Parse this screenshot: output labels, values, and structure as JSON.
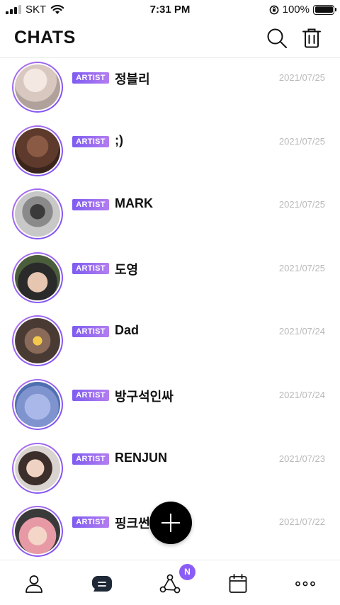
{
  "status_bar": {
    "carrier": "SKT",
    "time": "7:31 PM",
    "battery_percent": "100%"
  },
  "header": {
    "title": "CHATS",
    "search_icon": "search-icon",
    "trash_icon": "trash-icon"
  },
  "chats": [
    {
      "badge": "ARTIST",
      "name": "정블리",
      "date": "2021/07/25"
    },
    {
      "badge": "ARTIST",
      "name": ";)",
      "date": "2021/07/25"
    },
    {
      "badge": "ARTIST",
      "name": "MARK",
      "date": "2021/07/25"
    },
    {
      "badge": "ARTIST",
      "name": "도영",
      "date": "2021/07/25"
    },
    {
      "badge": "ARTIST",
      "name": "Dad",
      "date": "2021/07/24"
    },
    {
      "badge": "ARTIST",
      "name": "방구석인싸",
      "date": "2021/07/24"
    },
    {
      "badge": "ARTIST",
      "name": "RENJUN",
      "date": "2021/07/23"
    },
    {
      "badge": "ARTIST",
      "name": "핑크썬",
      "date": "2021/07/22"
    }
  ],
  "fab": {
    "icon": "plus-icon"
  },
  "tab_bar": {
    "badge": "N",
    "tabs": [
      {
        "icon": "person-icon"
      },
      {
        "icon": "chat-bubble-icon"
      },
      {
        "icon": "network-icon"
      },
      {
        "icon": "calendar-icon"
      },
      {
        "icon": "more-icon"
      }
    ]
  },
  "colors": {
    "accent_purple": "#8b5cf6",
    "badge_gradient_start": "#7d5cf0",
    "badge_gradient_end": "#b47df0",
    "date_gray": "#b9b9b9"
  }
}
